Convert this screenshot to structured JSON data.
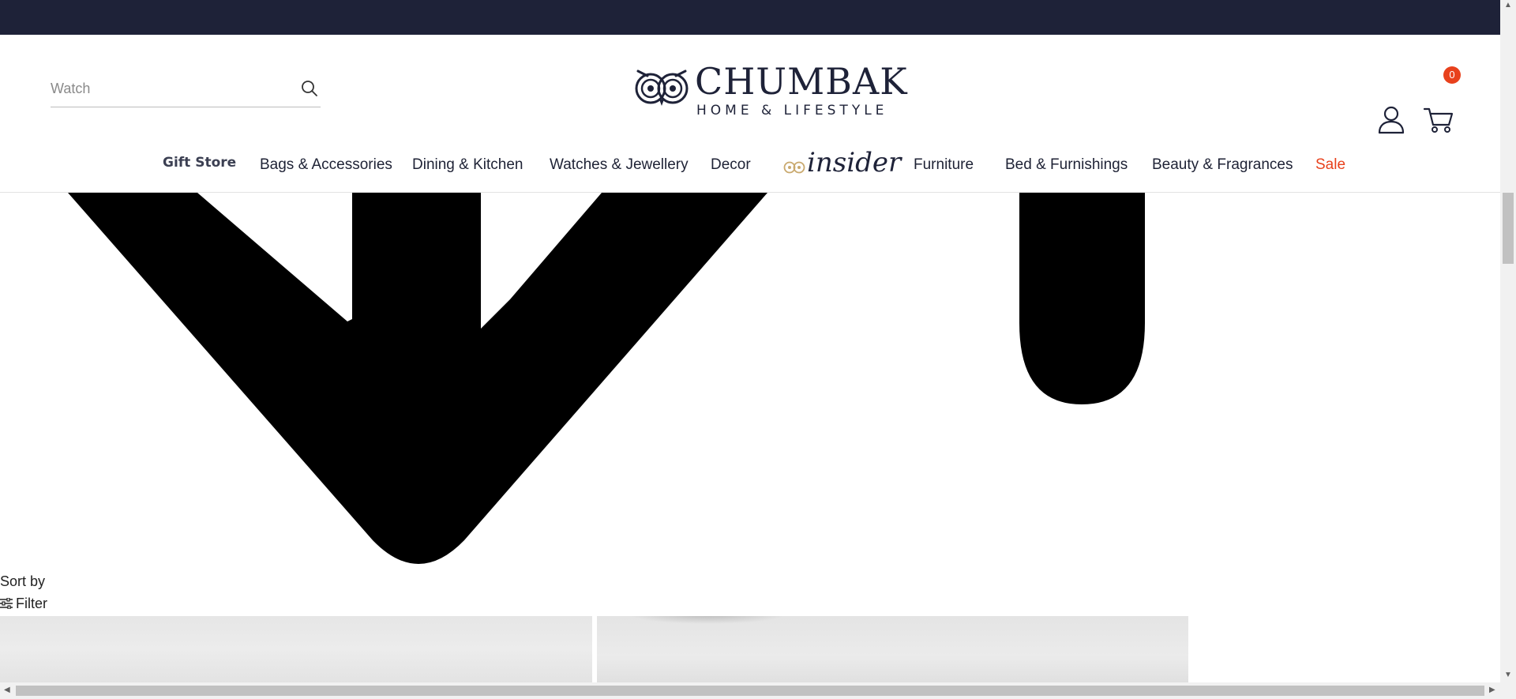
{
  "search": {
    "placeholder": "Watch"
  },
  "logo": {
    "name": "CHUMBAK",
    "tagline": "HOME & LIFESTYLE"
  },
  "cart": {
    "count": "0"
  },
  "nav": {
    "gift_store": "Gift Store",
    "items": [
      "Bags & Accessories",
      "Dining & Kitchen",
      "Watches & Jewellery",
      "Decor",
      "Furniture",
      "Bed & Furnishings",
      "Beauty & Fragrances",
      "Sale"
    ],
    "insider": "insider"
  },
  "listing": {
    "sort_label": "Sort by",
    "filter_label": "Filter"
  },
  "icons": [
    "search-icon",
    "owl-logo-icon",
    "account-icon",
    "cart-icon",
    "filter-icon",
    "owl-insider-icon"
  ],
  "colors": {
    "topbar": "#1e2238",
    "accent": "#e8411c",
    "text": "#1e2235"
  }
}
